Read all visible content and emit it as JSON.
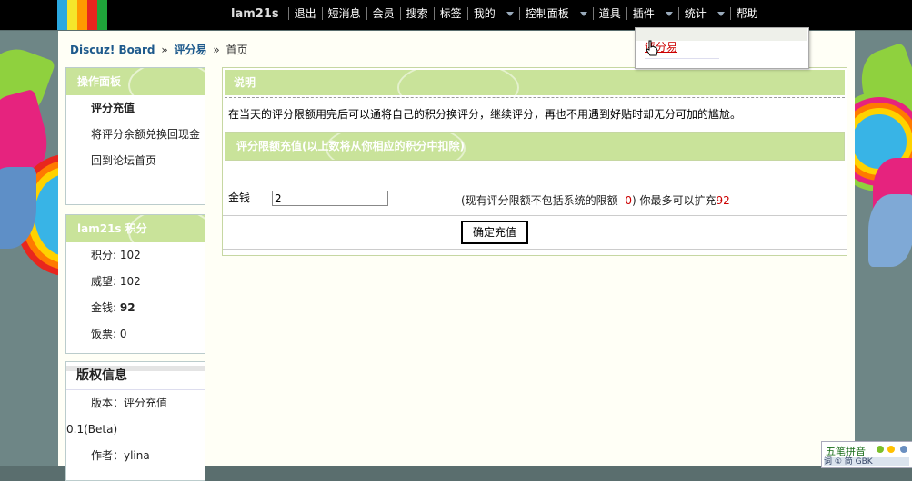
{
  "topbar": {
    "username": "lam21s",
    "items": [
      "退出",
      "短消息",
      "会员",
      "搜索",
      "标签",
      "我的",
      "控制面板",
      "道具",
      "插件",
      "统计",
      "帮助"
    ],
    "stripe_colors": [
      "#2ba8e0",
      "#f5e62b",
      "#ff9a00",
      "#e8261e",
      "#1fa53a"
    ]
  },
  "breadcrumb": {
    "site": "Discuz! Board",
    "section": "评分易",
    "page": "首页",
    "sep": "»"
  },
  "sidebar": {
    "panel_title": "操作面板",
    "panel_items": [
      "评分充值",
      "将评分余额兑换回现金",
      "回到论坛首页"
    ],
    "user_title": "lam21s 积分",
    "stats": [
      {
        "label": "积分:",
        "value": "102"
      },
      {
        "label": "威望:",
        "value": "102"
      },
      {
        "label": "金钱:",
        "value": "92"
      },
      {
        "label": "饭票:",
        "value": "0"
      }
    ],
    "copyright_title": "版权信息",
    "version": "版本：评分充值0.1(Beta)",
    "author": "作者：ylina"
  },
  "main": {
    "section_title": "说明",
    "description": "在当天的评分限额用完后可以通将自己的积分换评分，继续评分，再也不用遇到好贴时却无分可加的尴尬。",
    "form_title": "评分限额充值(以上数将从你相应的积分中扣除)",
    "field_label": "金钱",
    "field_value": "2",
    "note_prefix": "(现有评分限额不包括系统的限额",
    "note_limit": "0",
    "note_mid": ") 你最多可以扩充",
    "note_max": "92",
    "submit_label": "确定充值"
  },
  "dropdown": {
    "option": "评分易"
  },
  "ime": {
    "label": "五笔拼音",
    "lower": "词 ① 简 GBK"
  }
}
